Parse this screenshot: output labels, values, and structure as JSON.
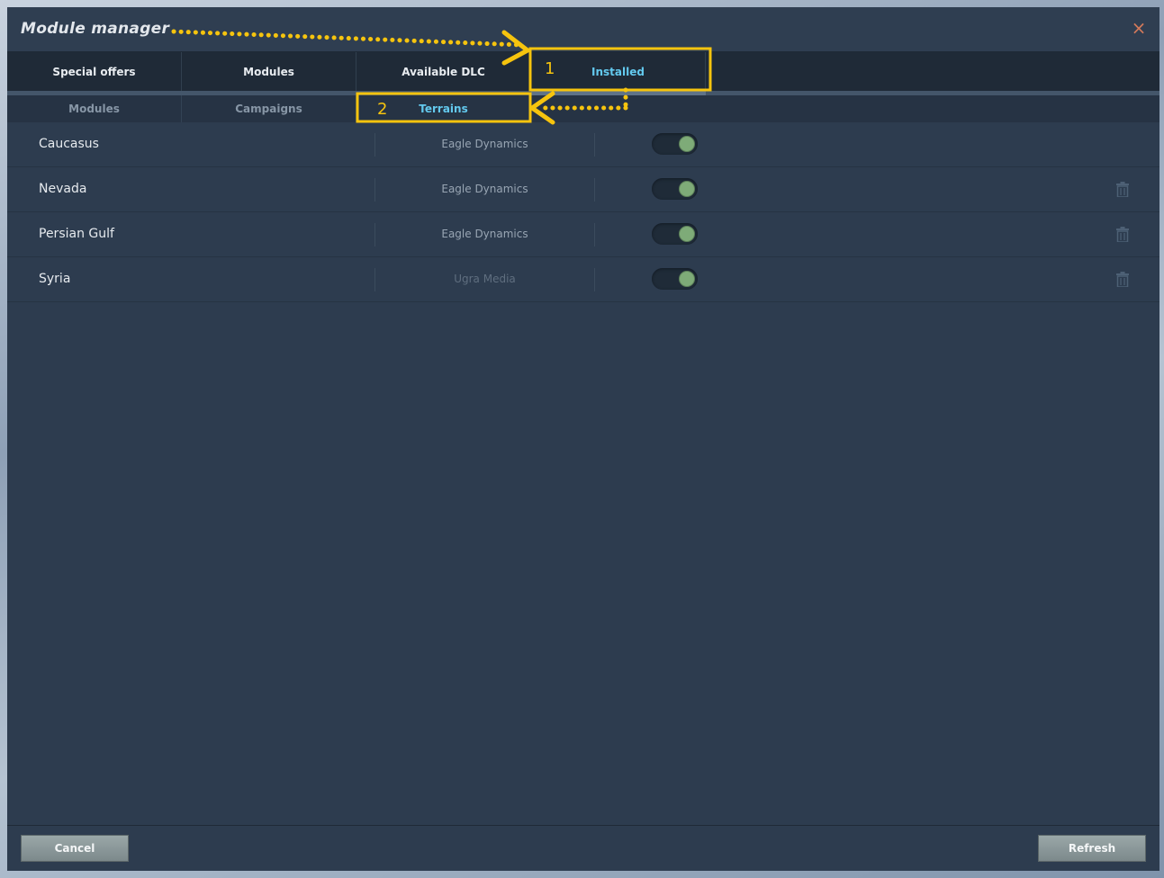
{
  "window": {
    "title": "Module manager",
    "close_icon": "close-icon"
  },
  "tabs": [
    {
      "label": "Special offers",
      "active": false
    },
    {
      "label": "Modules",
      "active": false
    },
    {
      "label": "Available DLC",
      "active": false
    },
    {
      "label": "Installed",
      "active": true
    }
  ],
  "subtabs": [
    {
      "label": "Modules",
      "active": false
    },
    {
      "label": "Campaigns",
      "active": false
    },
    {
      "label": "Terrains",
      "active": true
    }
  ],
  "terrains": [
    {
      "name": "Caucasus",
      "developer": "Eagle Dynamics",
      "enabled": true,
      "deletable": false
    },
    {
      "name": "Nevada",
      "developer": "Eagle Dynamics",
      "enabled": true,
      "deletable": true
    },
    {
      "name": "Persian Gulf",
      "developer": "Eagle Dynamics",
      "enabled": true,
      "deletable": true
    },
    {
      "name": "Syria",
      "developer": "Ugra Media",
      "enabled": true,
      "deletable": true
    }
  ],
  "footer": {
    "cancel_label": "Cancel",
    "refresh_label": "Refresh"
  },
  "annotations": {
    "step1": "1",
    "step2": "2",
    "color": "#f6c40e"
  },
  "colors": {
    "accent": "#63c9ee",
    "toggle_on": "#7eab78",
    "close": "#d2795a"
  }
}
